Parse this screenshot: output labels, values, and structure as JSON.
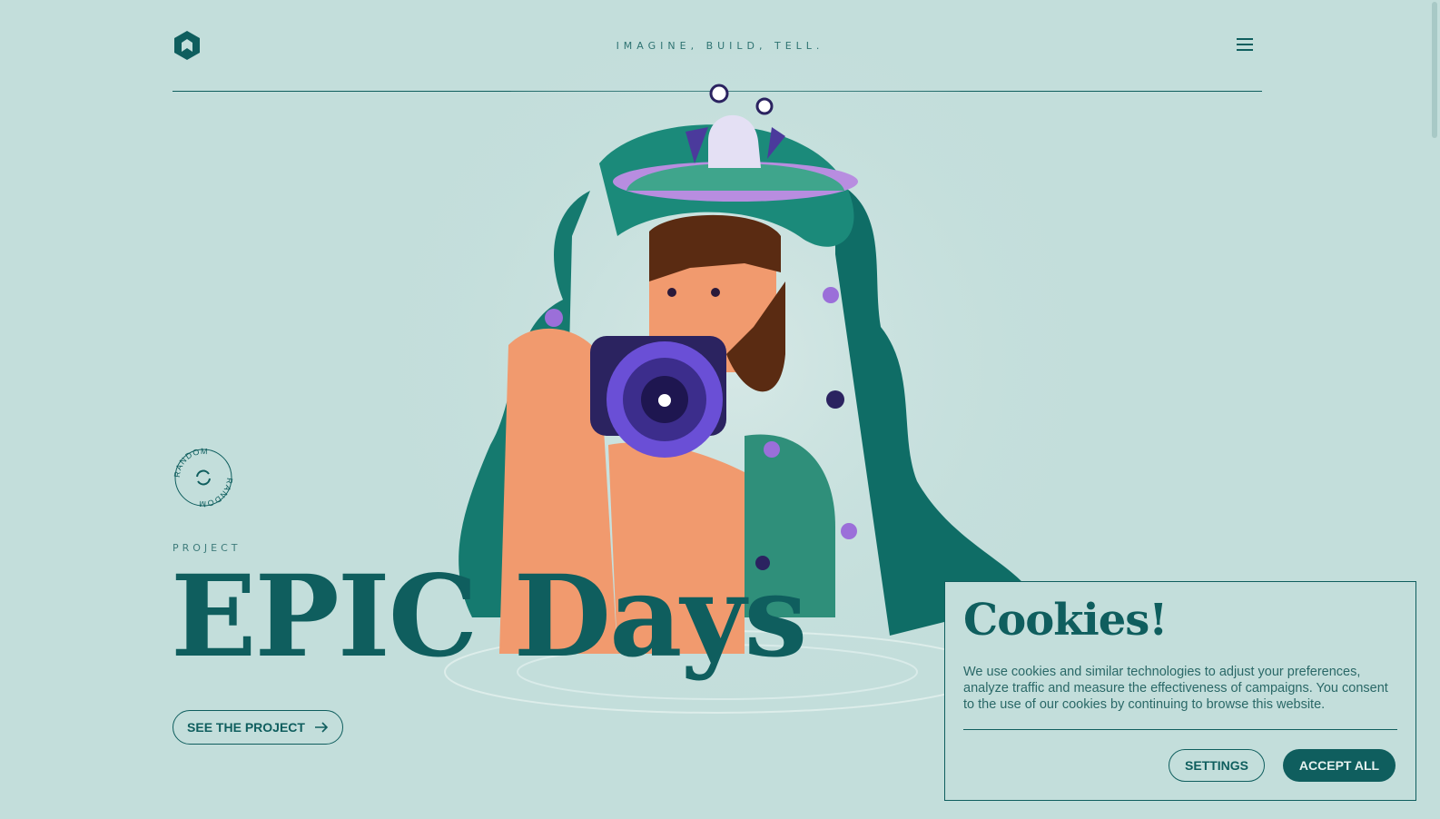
{
  "header": {
    "tagline": "IMAGINE, BUILD, TELL.",
    "logo_icon": "hexagon-logo-icon",
    "menu_icon": "hamburger-menu-icon"
  },
  "hero": {
    "random_label": "RANDOM",
    "random_icon": "refresh-icon",
    "section_label": "PROJECT",
    "title": "EPIC Days",
    "cta_label": "SEE THE PROJECT",
    "cta_icon": "arrow-right-icon",
    "illustration": "man-with-camera-and-frog-illustration"
  },
  "cookie_banner": {
    "title": "Cookies!",
    "text": "We use cookies and similar technologies to adjust your preferences, analyze traffic and measure the effectiveness of campaigns. You consent to the use of our cookies by continuing to browse this website.",
    "settings_label": "SETTINGS",
    "accept_label": "ACCEPT ALL"
  },
  "colors": {
    "background": "#c3dedb",
    "primary": "#0f5e5e",
    "accent_purple": "#6a4fd6"
  }
}
